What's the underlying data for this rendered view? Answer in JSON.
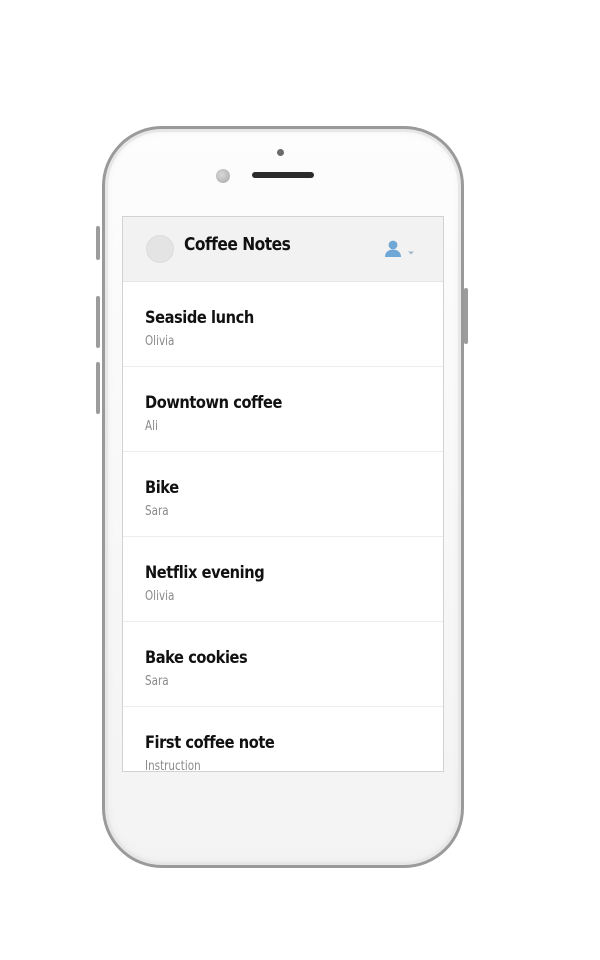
{
  "app": {
    "title": "Coffee Notes"
  },
  "header": {
    "user_menu_icon": "user-icon",
    "dropdown_icon": "caret-down-icon",
    "accent_color": "#6fa8d6"
  },
  "notes": [
    {
      "title": "Seaside lunch",
      "author": "Olivia"
    },
    {
      "title": "Downtown coffee",
      "author": "Ali"
    },
    {
      "title": "Bike",
      "author": "Sara"
    },
    {
      "title": "Netflix evening",
      "author": "Olivia"
    },
    {
      "title": "Bake cookies",
      "author": "Sara"
    },
    {
      "title": "First coffee note",
      "author": "Instruction"
    }
  ]
}
